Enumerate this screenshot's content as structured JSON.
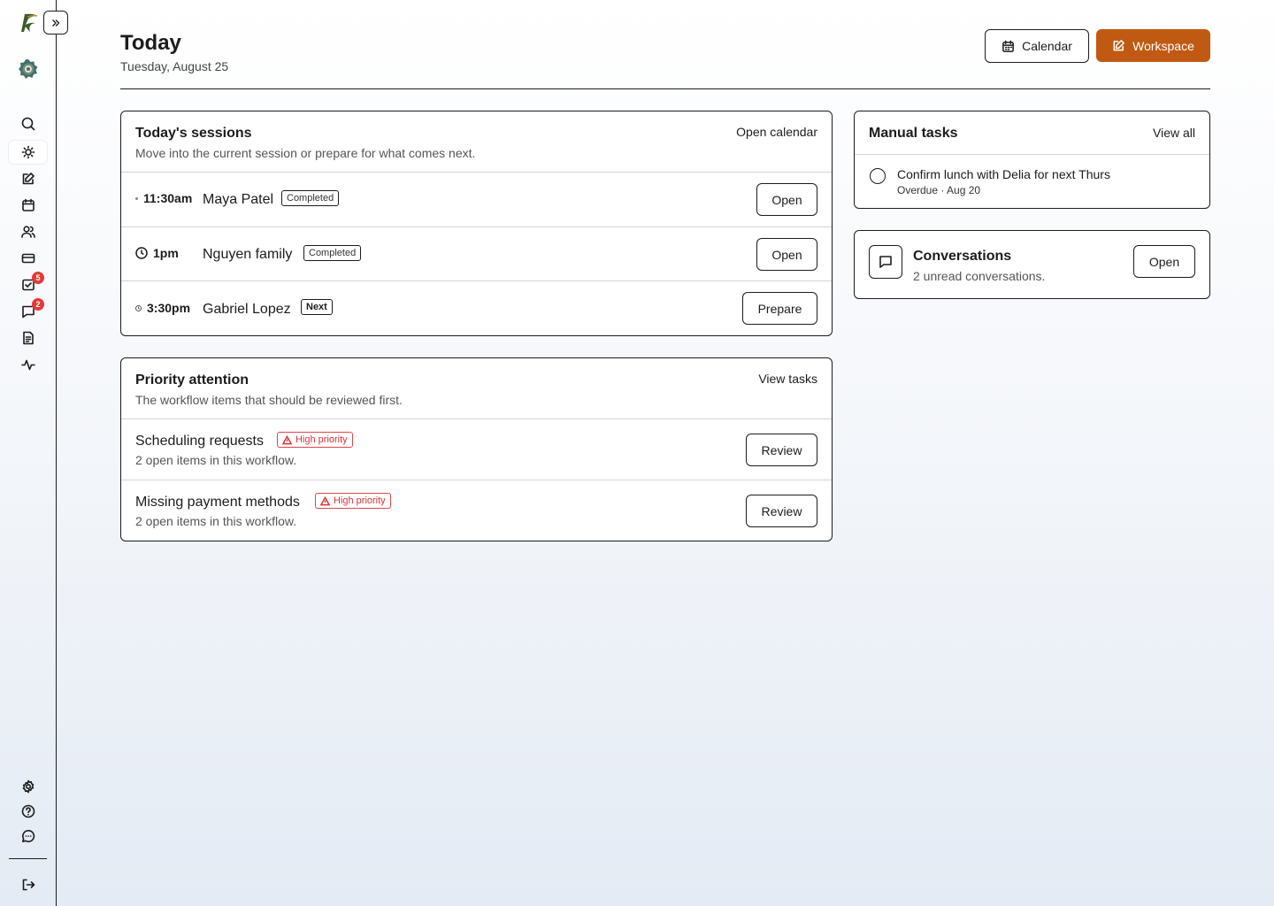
{
  "sidebar": {
    "items": [
      {
        "icon": "search-icon",
        "name": "search"
      },
      {
        "icon": "sun-icon",
        "name": "today",
        "active": true
      },
      {
        "icon": "edit-icon",
        "name": "workspace"
      },
      {
        "icon": "calendar-icon",
        "name": "calendar"
      },
      {
        "icon": "users-icon",
        "name": "clients"
      },
      {
        "icon": "credit-card-icon",
        "name": "billing"
      },
      {
        "icon": "checkbox-icon",
        "name": "tasks",
        "badge": "5"
      },
      {
        "icon": "message-icon",
        "name": "messages",
        "badge": "2"
      },
      {
        "icon": "document-icon",
        "name": "documents"
      },
      {
        "icon": "activity-icon",
        "name": "activity"
      }
    ],
    "badge_color": "#e53935"
  },
  "header": {
    "title": "Today",
    "subtitle": "Tuesday, August 25",
    "calendar_label": "Calendar",
    "workspace_label": "Workspace",
    "accent": "#c05a12"
  },
  "sessions": {
    "title": "Today's sessions",
    "description": "Move into the current session or prepare for what comes next.",
    "link": "Open calendar",
    "rows": [
      {
        "time": "11:30am",
        "name": "Maya Patel",
        "status": "Completed",
        "action": "Open"
      },
      {
        "time": "1pm",
        "name": "Nguyen family",
        "status": "Completed",
        "action": "Open"
      },
      {
        "time": "3:30pm",
        "name": "Gabriel Lopez",
        "status": "Next",
        "action": "Prepare"
      }
    ]
  },
  "priority": {
    "title": "Priority attention",
    "description": "The workflow items that should be reviewed first.",
    "link": "View tasks",
    "rows": [
      {
        "title": "Scheduling requests",
        "tag": "High priority",
        "desc": "2 open items in this workflow.",
        "action": "Review"
      },
      {
        "title": "Missing payment methods",
        "tag": "High priority",
        "desc": "2 open items in this workflow.",
        "action": "Review"
      }
    ]
  },
  "manual_tasks": {
    "title": "Manual tasks",
    "link": "View all",
    "task": {
      "title": "Confirm lunch with Delia for next Thurs",
      "meta": "Overdue · Aug 20"
    }
  },
  "conversations": {
    "title": "Conversations",
    "description": "2 unread conversations.",
    "action": "Open"
  }
}
